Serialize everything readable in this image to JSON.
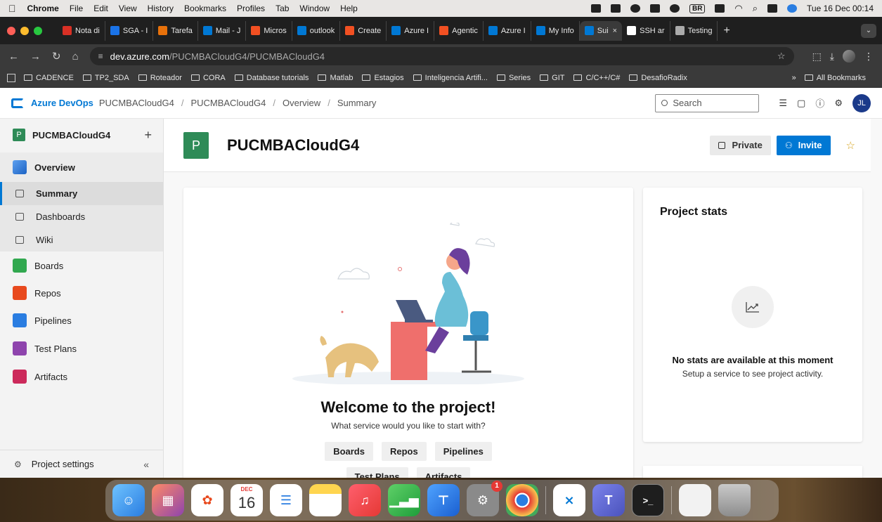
{
  "menubar": {
    "app": "Chrome",
    "items": [
      "File",
      "Edit",
      "View",
      "History",
      "Bookmarks",
      "Profiles",
      "Tab",
      "Window",
      "Help"
    ],
    "lang": "BR",
    "clock": "Tue 16 Dec  00:14"
  },
  "tabs": [
    {
      "label": "Nota di",
      "color": "#d93025"
    },
    {
      "label": "SGA - I",
      "color": "#1a73e8"
    },
    {
      "label": "Tarefa",
      "color": "#e8710a"
    },
    {
      "label": "Mail - J",
      "color": "#0078d4"
    },
    {
      "label": "Micros",
      "color": "#f25022"
    },
    {
      "label": "outlook",
      "color": "#0078d4"
    },
    {
      "label": "Create",
      "color": "#f25022"
    },
    {
      "label": "Azure I",
      "color": "#0078d4"
    },
    {
      "label": "Agentic",
      "color": "#f25022"
    },
    {
      "label": "Azure I",
      "color": "#0078d4"
    },
    {
      "label": "My Info",
      "color": "#0078d4"
    },
    {
      "label": "Sui",
      "color": "#0078d4",
      "active": true
    },
    {
      "label": "SSH ar",
      "color": "#ffffff"
    },
    {
      "label": "Testing",
      "color": "#aaaaaa"
    }
  ],
  "address": {
    "host": "dev.azure.com",
    "path": "/PUCMBACloudG4/PUCMBACloudG4"
  },
  "bookmarks": [
    "CADENCE",
    "TP2_SDA",
    "Roteador",
    "CORA",
    "Database tutorials",
    "Matlab",
    "Estagios",
    "Inteligencia Artifi...",
    "Series",
    "GIT",
    "C/C++/C#",
    "DesafioRadix"
  ],
  "bookmarks_all": "All Bookmarks",
  "bookmarks_more": "»",
  "header": {
    "brand": "Azure DevOps",
    "breadcrumbs": [
      "PUCMBACloudG4",
      "PUCMBACloudG4",
      "Overview",
      "Summary"
    ],
    "search_placeholder": "Search",
    "user_initials": "JL"
  },
  "sidebar": {
    "project_badge": "P",
    "project_name": "PUCMBACloudG4",
    "add": "+",
    "overview": "Overview",
    "sub_items": [
      "Summary",
      "Dashboards",
      "Wiki"
    ],
    "services": [
      {
        "label": "Boards",
        "color": "#31a84f"
      },
      {
        "label": "Repos",
        "color": "#e8491d"
      },
      {
        "label": "Pipelines",
        "color": "#2a7de1"
      },
      {
        "label": "Test Plans",
        "color": "#8e44ad"
      },
      {
        "label": "Artifacts",
        "color": "#cc2a5b"
      }
    ],
    "settings": "Project settings",
    "collapse": "«"
  },
  "main": {
    "badge": "P",
    "title": "PUCMBACloudG4",
    "private_label": "Private",
    "invite_label": "Invite",
    "welcome_title": "Welcome to the project!",
    "welcome_sub": "What service would you like to start with?",
    "service_buttons": [
      "Boards",
      "Repos",
      "Pipelines"
    ],
    "service_buttons_row2": [
      "Test Plans",
      "Artifacts"
    ],
    "stats_title": "Project stats",
    "stats_empty": "No stats are available at this moment",
    "stats_empty_sub": "Setup a service to see project activity."
  },
  "dock": {
    "calendar_month": "DEC",
    "calendar_day": "16",
    "settings_badge": "1"
  }
}
